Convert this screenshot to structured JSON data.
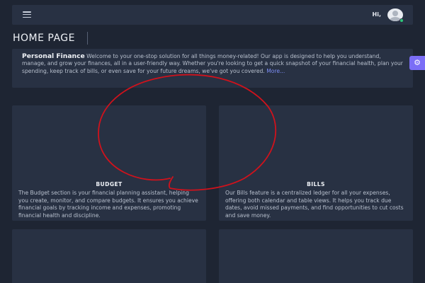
{
  "header": {
    "greeting": "Hi,"
  },
  "page": {
    "title": "HOME PAGE"
  },
  "intro": {
    "heading": "Personal Finance",
    "text": " Welcome to your one-stop solution for all things money-related! Our app is designed to help you understand, manage, and grow your finances, all in a user-friendly way. Whether you're looking to get a quick snapshot of your financial health, plan your spending, keep track of bills, or even save for your future dreams, we've got you covered. ",
    "more_link": "More..."
  },
  "cards": [
    {
      "title": "BUDGET",
      "description": "The Budget section is your financial planning assistant, helping you create, monitor, and compare budgets. It ensures you achieve financial goals by tracking income and expenses, promoting financial health and discipline."
    },
    {
      "title": "BILLS",
      "description": "Our Bills feature is a centralized ledger for all your expenses, offering both calendar and table views. It helps you track due dates, avoid missed payments, and find opportunities to cut costs and save money."
    }
  ],
  "icons": {
    "menu": "hamburger-icon",
    "avatar": "user-avatar-icon",
    "settings": "gear-icon"
  },
  "colors": {
    "background": "#1e2533",
    "panel": "#283143",
    "accent": "#7b6ef6",
    "link": "#7c8df5",
    "status_online": "#2fc87a",
    "annotation": "#d0121c"
  }
}
